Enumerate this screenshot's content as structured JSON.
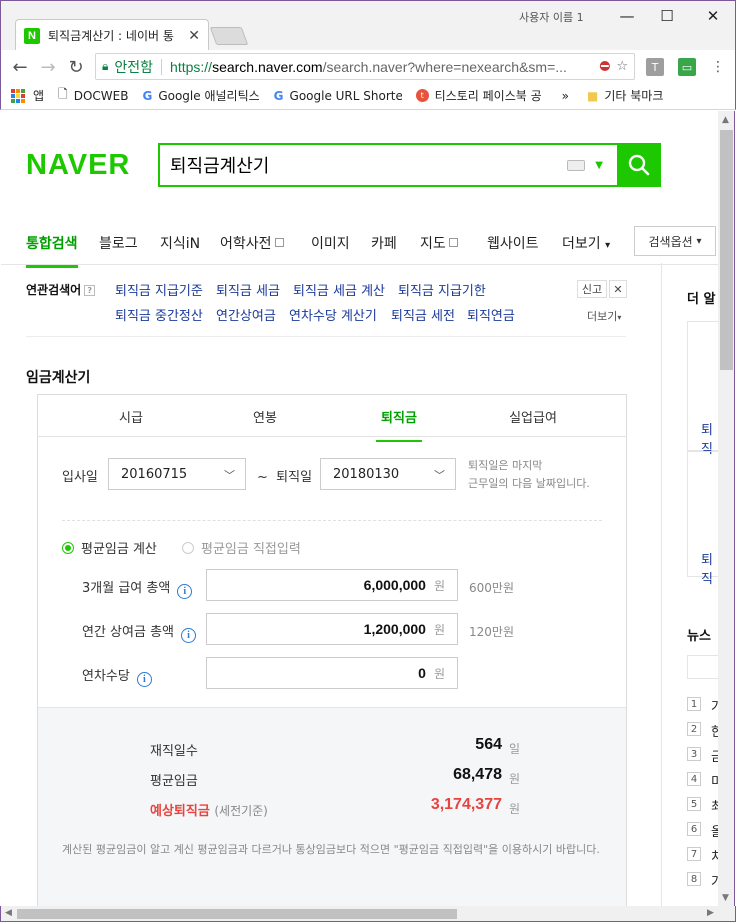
{
  "browser": {
    "tab_title": "퇴직금계산기 : 네이버 통",
    "tab_favicon": "N",
    "user_label": "사용자 이름 1",
    "secure_label": "안전함",
    "url_https": "https://",
    "url_host": "search.naver.com",
    "url_rest": "/search.naver?where=nexearch&sm=...",
    "bookmarks": [
      {
        "label": "앱",
        "icon": "apps-grid-icon"
      },
      {
        "label": "DOCWEB",
        "icon": "page-icon"
      },
      {
        "label": "Google 애널리틱스",
        "icon": "google-icon"
      },
      {
        "label": "Google URL Shorten",
        "icon": "google-icon"
      },
      {
        "label": "티스토리 페이스북 공",
        "icon": "tistory-icon"
      }
    ],
    "bookmarks_more": "»",
    "other_bookmarks": "기타 북마크"
  },
  "naver": {
    "logo": "NAVER",
    "query": "퇴직금계산기",
    "nav": [
      "통합검색",
      "블로그",
      "지식iN",
      "어학사전",
      "이미지",
      "카페",
      "지도",
      "웹사이트",
      "더보기"
    ],
    "search_options": "검색옵션",
    "related_title": "연관검색어",
    "related_row1": [
      "퇴직금 지급기준",
      "퇴직금 세금",
      "퇴직금 세금 계산",
      "퇴직금 지급기한"
    ],
    "related_row2": [
      "퇴직금 중간정산",
      "연간상여금",
      "연차수당 계산기",
      "퇴직금 세전",
      "퇴직연금"
    ],
    "report": "신고",
    "more": "더보기"
  },
  "calculator": {
    "title": "임금계산기",
    "tabs": [
      "시급",
      "연봉",
      "퇴직금",
      "실업급여"
    ],
    "active_tab": "퇴직금",
    "join_label": "입사일",
    "join_value": "20160715",
    "tilde": "~",
    "leave_label": "퇴직일",
    "leave_value": "20180130",
    "leave_hint_1": "퇴직일은 마지막",
    "leave_hint_2": "근무일의 다음 날짜입니다.",
    "radio_avg": "평균임금 계산",
    "radio_direct": "평균임금 직접입력",
    "row1_label": "3개월 급여 총액",
    "row1_value": "6,000,000",
    "row1_side": "600만원",
    "row2_label": "연간 상여금 총액",
    "row2_value": "1,200,000",
    "row2_side": "120만원",
    "row3_label": "연차수당",
    "row3_value": "0",
    "unit_won": "원",
    "res_days_label": "재직일수",
    "res_days_value": "564",
    "res_days_unit": "일",
    "res_avg_label": "평균임금",
    "res_avg_value": "68,478",
    "res_avg_unit": "원",
    "res_est_label": "예상퇴직금",
    "res_est_sub": "(세전기준)",
    "res_est_value": "3,174,377",
    "res_est_unit": "원",
    "note": "계산된 평균임금이 알고 계신 평균임금과 다르거나 통상임금보다 적으면 \"평균임금 직접입력\"을 이용하시기 바랍니다."
  },
  "rail": {
    "more_title": "더 알",
    "link1": "퇴직",
    "link2": "퇴직",
    "news_title": "뉴스",
    "ranks": [
      "1",
      "2",
      "3",
      "4",
      "5",
      "6",
      "7",
      "8"
    ],
    "rank_titles": [
      "가",
      "한",
      "금",
      "미",
      "최",
      "올",
      "치",
      "가"
    ]
  },
  "colors": {
    "naver_green": "#1ec800",
    "estimate_red": "#e8433f",
    "link_blue": "#1b3a9a"
  }
}
